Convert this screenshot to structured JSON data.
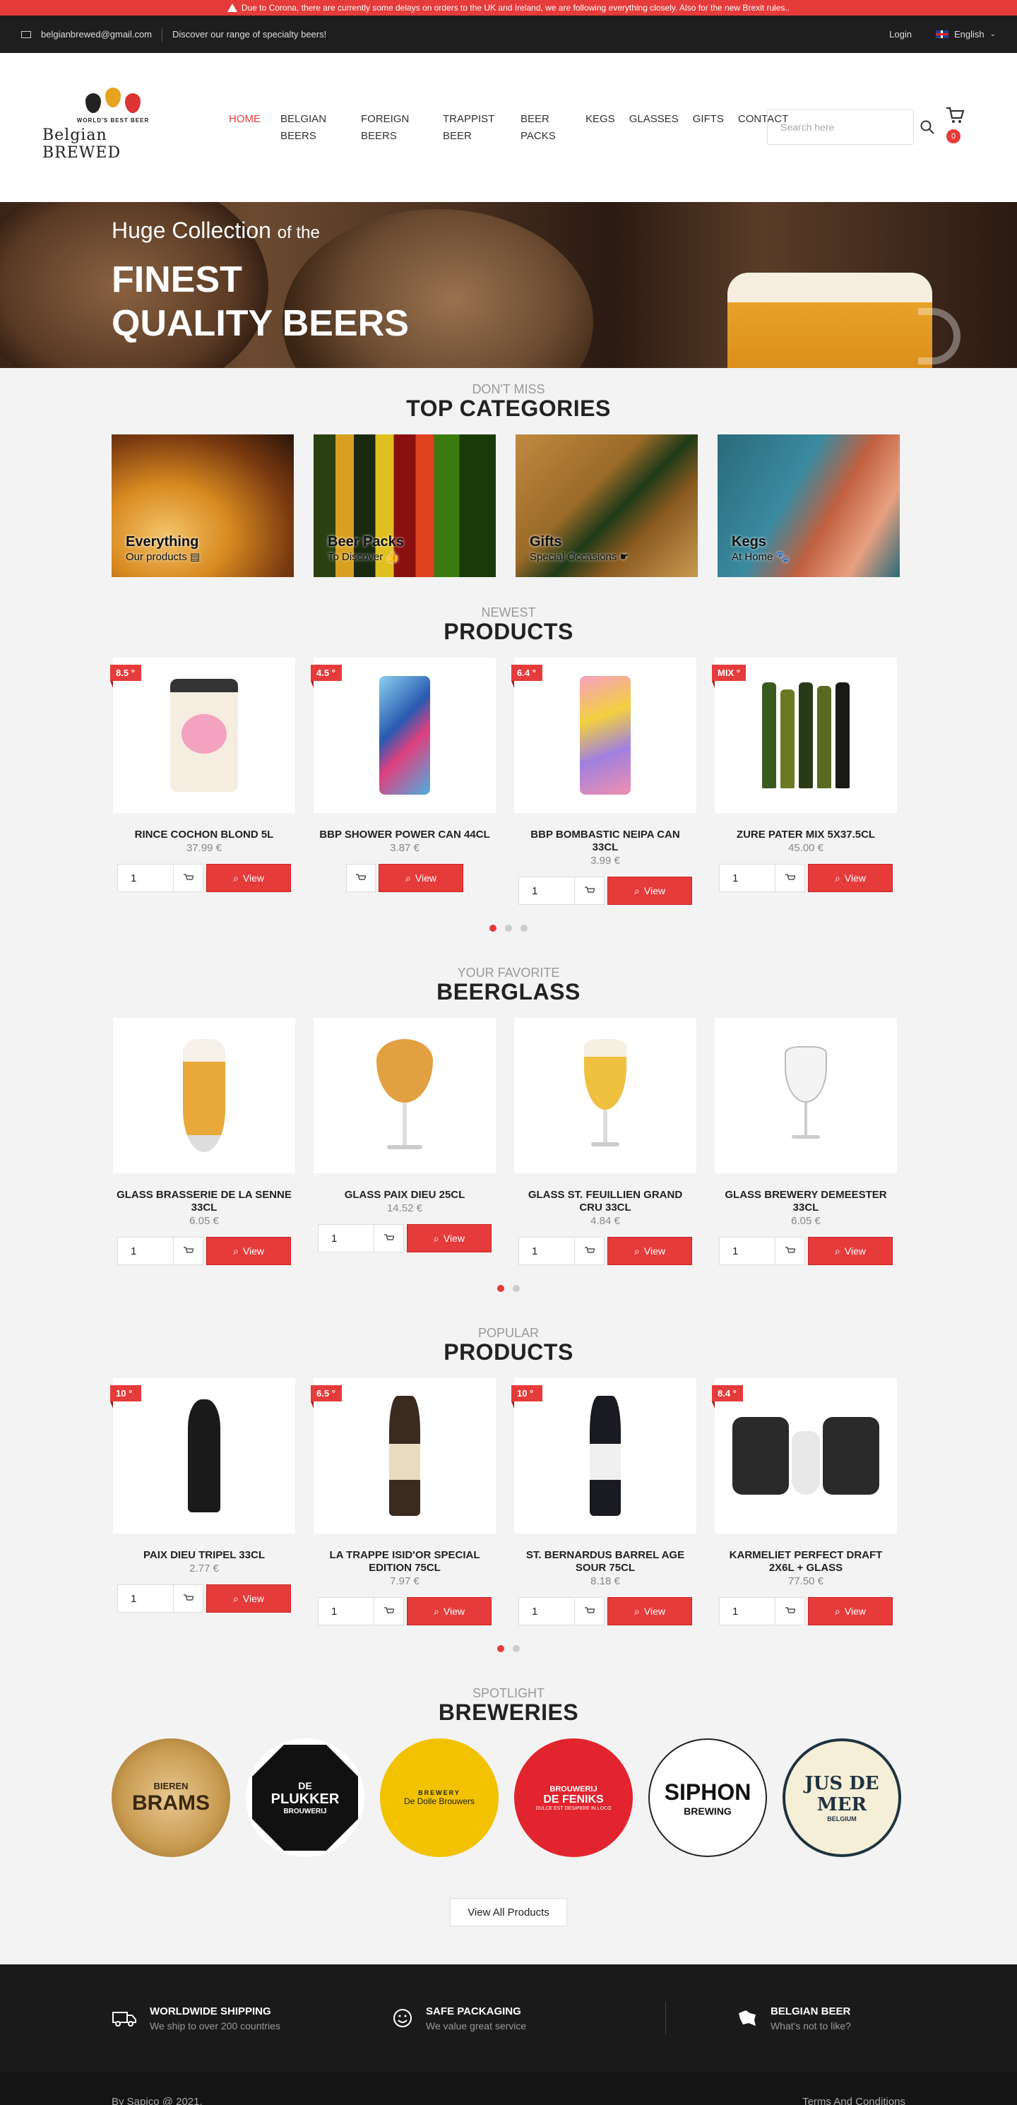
{
  "alert": {
    "text": "Due to Corona, there are currently some delays on orders to the UK and Ireland, we are following everything closely. Also for the new Brexit rules.."
  },
  "topbar": {
    "email": "belgianbrewed@gmail.com",
    "tagline": "Discover our range of specialty beers!",
    "login": "Login",
    "language": "English"
  },
  "logo": {
    "tag": "WORLD'S BEST BEER",
    "name": "Belgian BREWED"
  },
  "nav": {
    "items": [
      "HOME",
      "BELGIAN\nBEERS",
      "FOREIGN\nBEERS",
      "TRAPPIST\nBEER",
      "BEER\nPACKS",
      "KEGS",
      "GLASSES",
      "GIFTS",
      "CONTACT"
    ]
  },
  "search": {
    "placeholder": "Search here"
  },
  "cart": {
    "count": "0"
  },
  "hero": {
    "line1": "Huge Collection",
    "line1b": "of the",
    "line2": "FINEST",
    "line3": "QUALITY BEERS"
  },
  "categories": {
    "sub": "DON'T MISS",
    "title": "TOP CATEGORIES",
    "items": [
      {
        "title": "Everything",
        "sub": "Our products ▤"
      },
      {
        "title": "Beer Packs",
        "sub": "To Discover 👍"
      },
      {
        "title": "Gifts",
        "sub": "Special Occasions ☛"
      },
      {
        "title": "Kegs",
        "sub": "At Home 🐾"
      }
    ]
  },
  "newest": {
    "sub": "NEWEST",
    "title": "PRODUCTS",
    "items": [
      {
        "badge": "8.5 °",
        "name": "RINCE COCHON BLOND 5L",
        "price": "37.99 €",
        "qty": "1",
        "view": "View"
      },
      {
        "badge": "4.5 °",
        "name": "BBP SHOWER POWER CAN 44CL",
        "price": "3.87 €",
        "qty": "",
        "view": "View"
      },
      {
        "badge": "6.4 °",
        "name": "BBP BOMBASTIC NEIPA CAN 33CL",
        "price": "3.99 €",
        "qty": "1",
        "view": "View"
      },
      {
        "badge": "MIX °",
        "name": "ZURE PATER MIX 5X37.5CL",
        "price": "45.00 €",
        "qty": "1",
        "view": "View"
      }
    ]
  },
  "glasses": {
    "sub": "YOUR FAVORITE",
    "title": "BEERGLASS",
    "items": [
      {
        "name": "GLASS BRASSERIE DE LA SENNE 33CL",
        "price": "6.05 €",
        "qty": "1",
        "view": "View"
      },
      {
        "name": "GLASS PAIX DIEU 25CL",
        "price": "14.52 €",
        "qty": "1",
        "view": "View"
      },
      {
        "name": "GLASS ST. FEUILLIEN GRAND CRU 33CL",
        "price": "4.84 €",
        "qty": "1",
        "view": "View"
      },
      {
        "name": "GLASS BREWERY DEMEESTER 33CL",
        "price": "6.05 €",
        "qty": "1",
        "view": "View"
      }
    ]
  },
  "popular": {
    "sub": "POPULAR",
    "title": "PRODUCTS",
    "items": [
      {
        "badge": "10 °",
        "name": "PAIX DIEU TRIPEL 33CL",
        "price": "2.77 €",
        "qty": "1",
        "view": "View"
      },
      {
        "badge": "6.5 °",
        "name": "LA TRAPPE ISID'OR SPECIAL EDITION 75CL",
        "price": "7.97 €",
        "qty": "1",
        "view": "View"
      },
      {
        "badge": "10 °",
        "name": "ST. BERNARDUS BARREL AGE SOUR 75CL",
        "price": "8.18 €",
        "qty": "1",
        "view": "View"
      },
      {
        "badge": "8.4 °",
        "name": "KARMELIET PERFECT DRAFT 2X6L + GLASS",
        "price": "77.50 €",
        "qty": "1",
        "view": "View"
      }
    ]
  },
  "breweries": {
    "sub": "SPOTLIGHT",
    "title": "BREWERIES",
    "items": [
      {
        "name": "BRAMS",
        "top": "BIEREN"
      },
      {
        "name": "PLUKKER",
        "top": "DE",
        "bottom": "BROUWERIJ"
      },
      {
        "name": "De Dolle Brouwers",
        "top": "BREWERY"
      },
      {
        "name": "DE FENIKS",
        "top": "BROUWERIJ",
        "bottom": "DULCE EST DESIPERE IN LOCO"
      },
      {
        "name": "SIPHON",
        "bottom": "BREWING"
      },
      {
        "name": "JUS DE MER",
        "bottom": "BELGIUM"
      }
    ],
    "all_button": "View All Products"
  },
  "features": [
    {
      "title": "WORLDWIDE SHIPPING",
      "sub": "We ship to over 200 countries"
    },
    {
      "title": "SAFE PACKAGING",
      "sub": "We value great service"
    },
    {
      "title": "BELGIAN BEER",
      "sub": "What's not to like?"
    }
  ],
  "footer": {
    "copyright": "By Sapico @ 2021.",
    "terms": "Terms And Conditions"
  },
  "colors": {
    "accent": "#e63b3b",
    "dark": "#1e1e1e"
  }
}
